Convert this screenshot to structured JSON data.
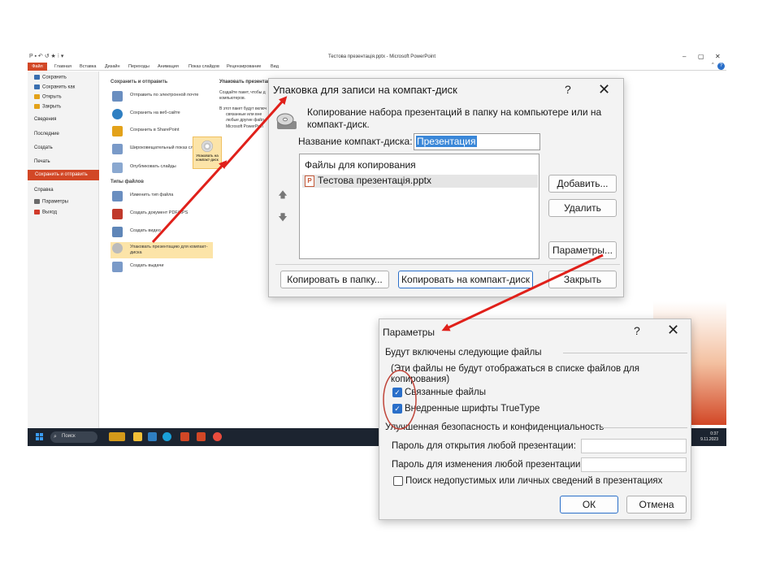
{
  "window": {
    "title": "Тестова презентація.pptx - Microsoft PowerPoint",
    "qat_glyphs": "P ▪ ↶ ↺ ★ ⁝ ▾",
    "min_glyph": "–",
    "max_glyph": "▢",
    "close_glyph": "✕",
    "help_glyph": "?",
    "collapse_glyph": "^"
  },
  "ribbon": {
    "tabs": [
      "Файл",
      "Главная",
      "Вставка",
      "Дизайн",
      "Переходы",
      "Анимация",
      "Показ слайдов",
      "Рецензирование",
      "Вид"
    ]
  },
  "leftnav": {
    "items": [
      {
        "label": "Сохранить",
        "icon": "save-icon",
        "color": "#3a6fb0"
      },
      {
        "label": "Сохранить как",
        "icon": "save-as-icon",
        "color": "#3a6fb0"
      },
      {
        "label": "Открыть",
        "icon": "folder-icon",
        "color": "#e3a21a"
      },
      {
        "label": "Закрыть",
        "icon": "close-file-icon",
        "color": "#e3a21a"
      }
    ],
    "sections": [
      "Сведения",
      "Последние",
      "Создать",
      "Печать"
    ],
    "selected": "Сохранить и отправить",
    "help": "Справка",
    "sub": [
      {
        "label": "Параметры",
        "icon": "options-icon",
        "color": "#6a6a6a"
      },
      {
        "label": "Выход",
        "icon": "exit-icon",
        "color": "#d03a2a"
      }
    ]
  },
  "middle": {
    "section1": "Сохранить и отправить",
    "items1": [
      {
        "label": "Отправить по электронной почте",
        "icon": "email-icon",
        "color": "#6a8ec0"
      },
      {
        "label": "Сохранить на веб-сайте",
        "icon": "globe-icon",
        "color": "#2f7fc2"
      },
      {
        "label": "Сохранить в SharePoint",
        "icon": "sharepoint-icon",
        "color": "#e3a21a"
      },
      {
        "label": "Широковещательный показ слайдов",
        "icon": "broadcast-icon",
        "color": "#7a9ac8"
      },
      {
        "label": "Опубликовать слайды",
        "icon": "publish-icon",
        "color": "#8aa8d0"
      }
    ],
    "section2": "Типы файлов",
    "items2": [
      {
        "label": "Изменить тип файла",
        "icon": "file-type-icon",
        "color": "#6a8ec0"
      },
      {
        "label": "Создать документ PDF/XPS",
        "icon": "pdf-icon",
        "color": "#c0392b"
      },
      {
        "label": "Создать видео",
        "icon": "video-icon",
        "color": "#5f86b8"
      },
      {
        "label": "Упаковать презентацию для компакт-диска",
        "icon": "cd-package-icon",
        "color": "#bbbbbb",
        "selected": true
      },
      {
        "label": "Создать выдачи",
        "icon": "handouts-icon",
        "color": "#7a9ac8"
      }
    ]
  },
  "right": {
    "header": "Упаковать презентаци",
    "desc": "Создайте пакет, чтобы д компьютеров.",
    "list_intro": "В этот пакет будут включ",
    "bullets": [
      "связанные или вне",
      "любые другие файл",
      "Microsoft PowerPoin"
    ],
    "tile_label": "Упаковать на компакт-диск"
  },
  "taskbar": {
    "search": "Поиск",
    "time": "0:37",
    "date": "9.11.2023",
    "search_glyph": "⌕"
  },
  "cd_dialog": {
    "title": "Упаковка для записи на компакт-диск",
    "help_glyph": "?",
    "close_glyph": "✕",
    "description": "Копирование набора презентаций в папку на компьютере или на компакт-диск.",
    "name_label": "Название компакт-диска:",
    "name_value": "Презентация",
    "files_header": "Файлы для копирования",
    "file": "Тестова презентація.pptx",
    "file_icon": "P",
    "up_glyph": "🡅",
    "down_glyph": "🡇",
    "add": "Добавить...",
    "remove": "Удалить",
    "options": "Параметры...",
    "copy_folder": "Копировать в папку...",
    "copy_cd": "Копировать на компакт-диск",
    "close": "Закрыть"
  },
  "params_dialog": {
    "title": "Параметры",
    "help_glyph": "?",
    "close_glyph": "✕",
    "group1": "Будут включены следующие файлы",
    "note": "(Эти файлы не будут отображаться в списке файлов для копирования)",
    "linked": {
      "label": "Связанные файлы",
      "checked": true
    },
    "embedded": {
      "label": "Внедренные шрифты TrueType",
      "checked": true
    },
    "group2": "Улучшенная безопасность и конфиденциальность",
    "pwd_open": "Пароль для открытия любой презентации:",
    "pwd_modify": "Пароль для изменения любой презентации:",
    "inspect": {
      "label": "Поиск недопустимых или личных сведений в презентациях",
      "checked": false
    },
    "ok": "ОК",
    "cancel": "Отмена",
    "check_glyph": "✓"
  },
  "colors": {
    "accent": "#d24726",
    "arrow": "#e0201a",
    "dialog_primary": "#2a6fc9"
  }
}
